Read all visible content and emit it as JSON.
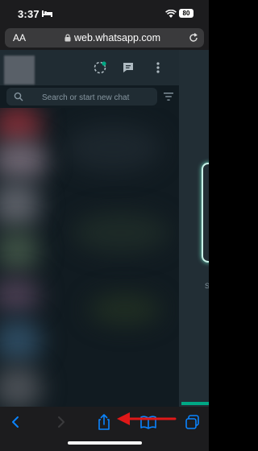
{
  "status_bar": {
    "time": "3:37",
    "battery": "80"
  },
  "address_bar": {
    "text_size_label": "AA",
    "url": "web.whatsapp.com"
  },
  "whatsapp": {
    "search_placeholder": "Search or start new chat",
    "right_panel_partial_text": "S"
  },
  "toolbar": {
    "items": [
      "back-icon",
      "forward-icon",
      "share-icon",
      "bookmarks-icon",
      "tabs-icon"
    ],
    "accent_color": "#0a84ff",
    "annotation_arrow_color": "#e01818"
  },
  "colors": {
    "panel_bg": "#111b21",
    "header_bg": "#202c33",
    "status_ring": "#00a884"
  }
}
